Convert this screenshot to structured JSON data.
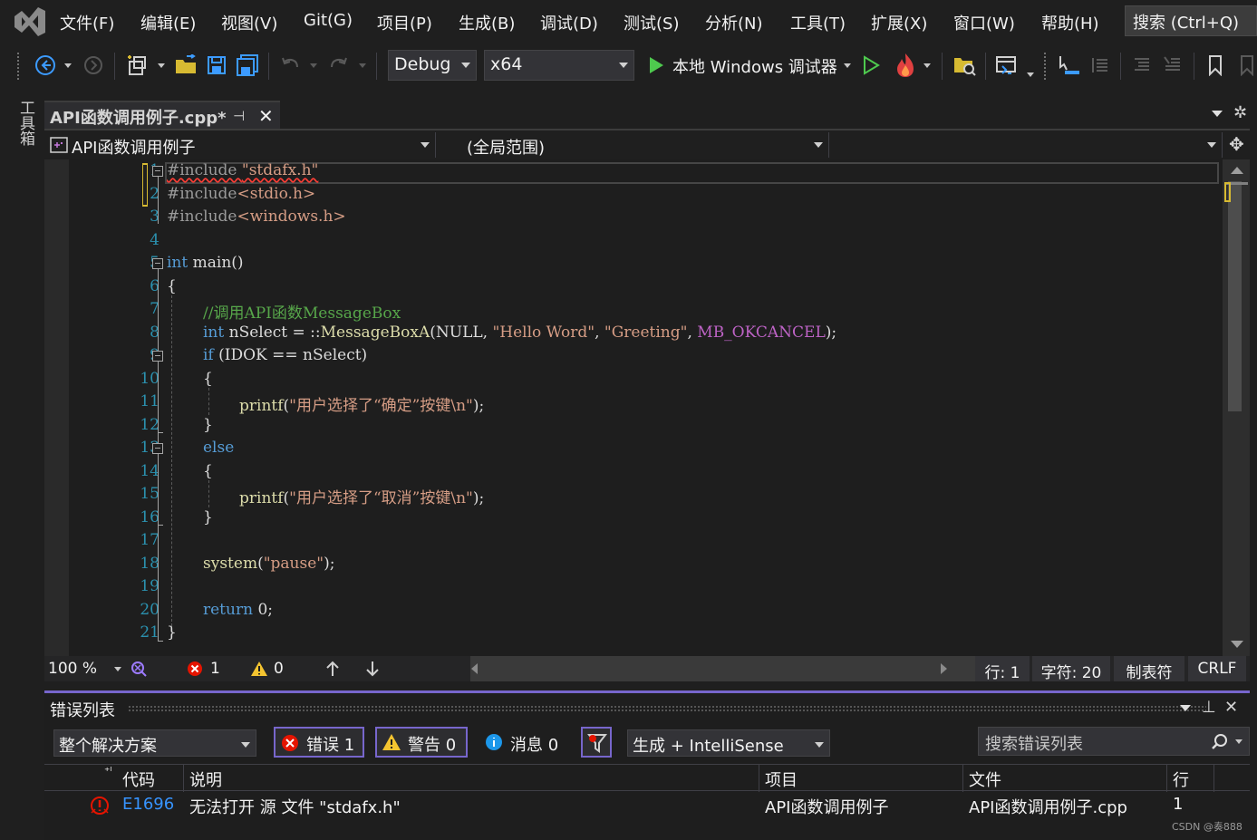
{
  "menu": {
    "items": [
      "文件(F)",
      "编辑(E)",
      "视图(V)",
      "Git(G)",
      "项目(P)",
      "生成(B)",
      "调试(D)",
      "测试(S)",
      "分析(N)",
      "工具(T)",
      "扩展(X)",
      "窗口(W)",
      "帮助(H)"
    ],
    "search_placeholder": "搜索 (Ctrl+Q)"
  },
  "toolbar": {
    "configuration": "Debug",
    "platform": "x64",
    "debugger_label": "本地 Windows 调试器"
  },
  "toolbox_label": "工具箱",
  "doc_tab": {
    "title": "API函数调用例子.cpp*"
  },
  "navbar": {
    "project": "API函数调用例子",
    "scope": "(全局范围)",
    "member": ""
  },
  "editor": {
    "line_numbers": [
      "1",
      "2",
      "3",
      "4",
      "5",
      "6",
      "7",
      "8",
      "9",
      "10",
      "11",
      "12",
      "13",
      "14",
      "15",
      "16",
      "17",
      "18",
      "19",
      "20",
      "21"
    ],
    "code": {
      "l1_a": "#include ",
      "l1_b": "\"stdafx.h\"",
      "l2_a": "#include",
      "l2_b": "<stdio.h>",
      "l3_a": "#include",
      "l3_b": "<windows.h>",
      "l5_a": "int",
      "l5_b": " main()",
      "l6": "{",
      "l7": "//调用API函数MessageBox",
      "l8_a": "int",
      "l8_b": " nSelect = ::",
      "l8_c": "MessageBoxA",
      "l8_d": "(NULL, ",
      "l8_e": "\"Hello Word\"",
      "l8_f": ", ",
      "l8_g": "\"Greeting\"",
      "l8_h": ", ",
      "l8_i": "MB_OKCANCEL",
      "l8_j": ");",
      "l9_a": "if",
      "l9_b": " (IDOK == nSelect)",
      "l10": "{",
      "l11_a": "printf",
      "l11_b": "(",
      "l11_c": "\"用户选择了“确定”按键\\n\"",
      "l11_d": ");",
      "l12": "}",
      "l13": "else",
      "l14": "{",
      "l15_a": "printf",
      "l15_b": "(",
      "l15_c": "\"用户选择了“取消”按键\\n\"",
      "l15_d": ");",
      "l16": "}",
      "l18_a": "system",
      "l18_b": "(",
      "l18_c": "\"pause\"",
      "l18_d": ");",
      "l20_a": "return",
      "l20_b": " 0;",
      "l21": "}"
    }
  },
  "editor_status": {
    "zoom": "100 %",
    "errors": "1",
    "warnings": "0",
    "line": "行: 1",
    "char": "字符: 20",
    "indent": "制表符",
    "eol": "CRLF"
  },
  "error_list": {
    "title": "错误列表",
    "scope": "整个解决方案",
    "errors_btn": "错误 1",
    "warnings_btn": "警告 0",
    "messages_btn": "消息 0",
    "build_filter": "生成 + IntelliSense",
    "search_placeholder": "搜索错误列表",
    "columns": {
      "code": "代码",
      "desc": "说明",
      "project": "项目",
      "file": "文件",
      "line": "行"
    },
    "rows": [
      {
        "code": "E1696",
        "desc": "无法打开 源 文件 \"stdafx.h\"",
        "project": "API函数调用例子",
        "file": "API函数调用例子.cpp",
        "line": "1"
      }
    ]
  },
  "watermark": "CSDN @奏888",
  "colors": {
    "accent": "#7766cc",
    "keyword": "#569cd6",
    "string": "#d69d85",
    "comment": "#57a64a",
    "line_number": "#2b91af",
    "error": "#e51400"
  }
}
